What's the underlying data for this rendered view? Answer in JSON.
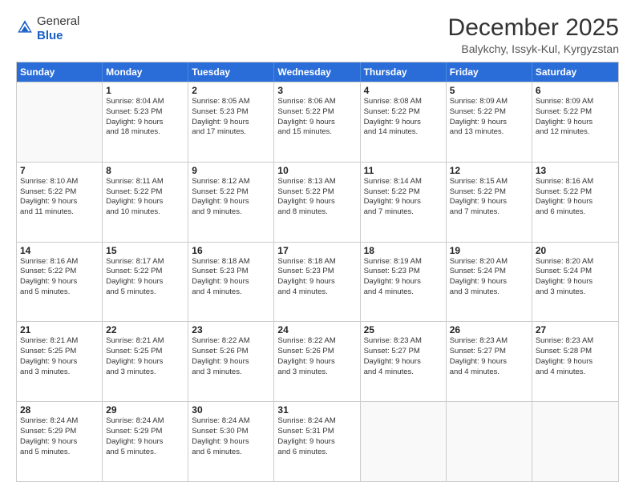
{
  "logo": {
    "general": "General",
    "blue": "Blue"
  },
  "title": "December 2025",
  "location": "Balykchy, Issyk-Kul, Kyrgyzstan",
  "header_days": [
    "Sunday",
    "Monday",
    "Tuesday",
    "Wednesday",
    "Thursday",
    "Friday",
    "Saturday"
  ],
  "weeks": [
    [
      {
        "day": "",
        "info": ""
      },
      {
        "day": "1",
        "info": "Sunrise: 8:04 AM\nSunset: 5:23 PM\nDaylight: 9 hours\nand 18 minutes."
      },
      {
        "day": "2",
        "info": "Sunrise: 8:05 AM\nSunset: 5:23 PM\nDaylight: 9 hours\nand 17 minutes."
      },
      {
        "day": "3",
        "info": "Sunrise: 8:06 AM\nSunset: 5:22 PM\nDaylight: 9 hours\nand 15 minutes."
      },
      {
        "day": "4",
        "info": "Sunrise: 8:08 AM\nSunset: 5:22 PM\nDaylight: 9 hours\nand 14 minutes."
      },
      {
        "day": "5",
        "info": "Sunrise: 8:09 AM\nSunset: 5:22 PM\nDaylight: 9 hours\nand 13 minutes."
      },
      {
        "day": "6",
        "info": "Sunrise: 8:09 AM\nSunset: 5:22 PM\nDaylight: 9 hours\nand 12 minutes."
      }
    ],
    [
      {
        "day": "7",
        "info": "Sunrise: 8:10 AM\nSunset: 5:22 PM\nDaylight: 9 hours\nand 11 minutes."
      },
      {
        "day": "8",
        "info": "Sunrise: 8:11 AM\nSunset: 5:22 PM\nDaylight: 9 hours\nand 10 minutes."
      },
      {
        "day": "9",
        "info": "Sunrise: 8:12 AM\nSunset: 5:22 PM\nDaylight: 9 hours\nand 9 minutes."
      },
      {
        "day": "10",
        "info": "Sunrise: 8:13 AM\nSunset: 5:22 PM\nDaylight: 9 hours\nand 8 minutes."
      },
      {
        "day": "11",
        "info": "Sunrise: 8:14 AM\nSunset: 5:22 PM\nDaylight: 9 hours\nand 7 minutes."
      },
      {
        "day": "12",
        "info": "Sunrise: 8:15 AM\nSunset: 5:22 PM\nDaylight: 9 hours\nand 7 minutes."
      },
      {
        "day": "13",
        "info": "Sunrise: 8:16 AM\nSunset: 5:22 PM\nDaylight: 9 hours\nand 6 minutes."
      }
    ],
    [
      {
        "day": "14",
        "info": "Sunrise: 8:16 AM\nSunset: 5:22 PM\nDaylight: 9 hours\nand 5 minutes."
      },
      {
        "day": "15",
        "info": "Sunrise: 8:17 AM\nSunset: 5:22 PM\nDaylight: 9 hours\nand 5 minutes."
      },
      {
        "day": "16",
        "info": "Sunrise: 8:18 AM\nSunset: 5:23 PM\nDaylight: 9 hours\nand 4 minutes."
      },
      {
        "day": "17",
        "info": "Sunrise: 8:18 AM\nSunset: 5:23 PM\nDaylight: 9 hours\nand 4 minutes."
      },
      {
        "day": "18",
        "info": "Sunrise: 8:19 AM\nSunset: 5:23 PM\nDaylight: 9 hours\nand 4 minutes."
      },
      {
        "day": "19",
        "info": "Sunrise: 8:20 AM\nSunset: 5:24 PM\nDaylight: 9 hours\nand 3 minutes."
      },
      {
        "day": "20",
        "info": "Sunrise: 8:20 AM\nSunset: 5:24 PM\nDaylight: 9 hours\nand 3 minutes."
      }
    ],
    [
      {
        "day": "21",
        "info": "Sunrise: 8:21 AM\nSunset: 5:25 PM\nDaylight: 9 hours\nand 3 minutes."
      },
      {
        "day": "22",
        "info": "Sunrise: 8:21 AM\nSunset: 5:25 PM\nDaylight: 9 hours\nand 3 minutes."
      },
      {
        "day": "23",
        "info": "Sunrise: 8:22 AM\nSunset: 5:26 PM\nDaylight: 9 hours\nand 3 minutes."
      },
      {
        "day": "24",
        "info": "Sunrise: 8:22 AM\nSunset: 5:26 PM\nDaylight: 9 hours\nand 3 minutes."
      },
      {
        "day": "25",
        "info": "Sunrise: 8:23 AM\nSunset: 5:27 PM\nDaylight: 9 hours\nand 4 minutes."
      },
      {
        "day": "26",
        "info": "Sunrise: 8:23 AM\nSunset: 5:27 PM\nDaylight: 9 hours\nand 4 minutes."
      },
      {
        "day": "27",
        "info": "Sunrise: 8:23 AM\nSunset: 5:28 PM\nDaylight: 9 hours\nand 4 minutes."
      }
    ],
    [
      {
        "day": "28",
        "info": "Sunrise: 8:24 AM\nSunset: 5:29 PM\nDaylight: 9 hours\nand 5 minutes."
      },
      {
        "day": "29",
        "info": "Sunrise: 8:24 AM\nSunset: 5:29 PM\nDaylight: 9 hours\nand 5 minutes."
      },
      {
        "day": "30",
        "info": "Sunrise: 8:24 AM\nSunset: 5:30 PM\nDaylight: 9 hours\nand 6 minutes."
      },
      {
        "day": "31",
        "info": "Sunrise: 8:24 AM\nSunset: 5:31 PM\nDaylight: 9 hours\nand 6 minutes."
      },
      {
        "day": "",
        "info": ""
      },
      {
        "day": "",
        "info": ""
      },
      {
        "day": "",
        "info": ""
      }
    ]
  ]
}
